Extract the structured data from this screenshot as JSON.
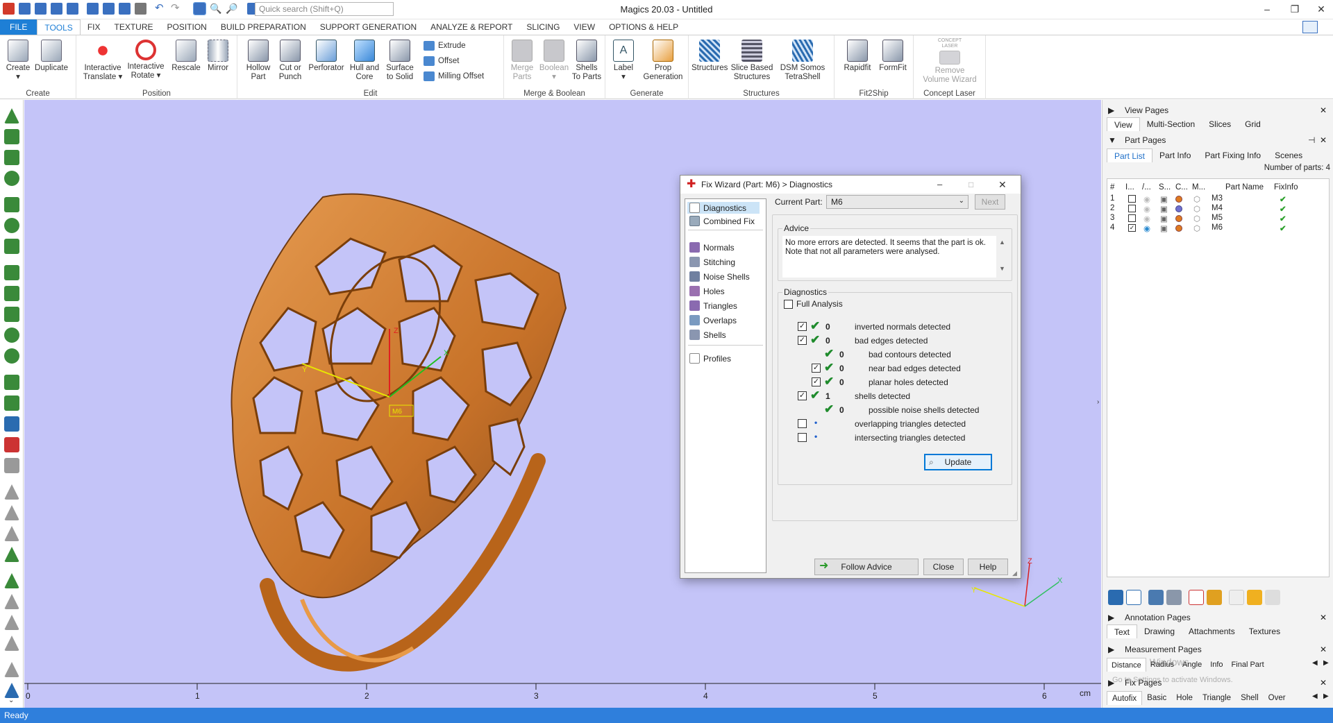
{
  "app": {
    "title": "Magics 20.03 - Untitled",
    "search_placeholder": "Quick search (Shift+Q)",
    "status": "Ready"
  },
  "menu_tabs": [
    "FILE",
    "TOOLS",
    "FIX",
    "TEXTURE",
    "POSITION",
    "BUILD PREPARATION",
    "SUPPORT GENERATION",
    "ANALYZE & REPORT",
    "SLICING",
    "VIEW",
    "OPTIONS & HELP"
  ],
  "ribbon": {
    "groups": [
      {
        "label": "Create",
        "buttons": [
          "Create",
          "Duplicate"
        ]
      },
      {
        "label": "Position",
        "buttons": [
          "Interactive Translate",
          "Interactive Rotate",
          "Rescale",
          "Mirror"
        ]
      },
      {
        "label": "Edit",
        "buttons": [
          "Hollow Part",
          "Cut or Punch",
          "Perforator",
          "Hull and Core",
          "Surface to Solid"
        ],
        "small": [
          "Extrude",
          "Offset",
          "Milling Offset"
        ]
      },
      {
        "label": "Merge & Boolean",
        "buttons": [
          "Merge Parts",
          "Boolean",
          "Shells To Parts"
        ]
      },
      {
        "label": "Generate",
        "buttons": [
          "Label",
          "Prop Generation"
        ]
      },
      {
        "label": "Structures",
        "buttons": [
          "Structures",
          "Slice Based Structures",
          "DSM Somos TetraShell"
        ]
      },
      {
        "label": "Fit2Ship",
        "buttons": [
          "Rapidfit",
          "FormFit"
        ]
      },
      {
        "label": "Concept Laser",
        "buttons": [
          "Remove Volume Wizard"
        ],
        "badge": "CONCEPT LASER"
      }
    ]
  },
  "viewport": {
    "ruler_ticks": [
      "0",
      "1",
      "2",
      "3",
      "4",
      "5",
      "6"
    ],
    "ruler_unit": "cm",
    "axis_labels": {
      "x": "X",
      "y": "Y",
      "z": "Z"
    },
    "part_tag": "M6"
  },
  "dialog": {
    "title": "Fix Wizard (Part: M6) > Diagnostics",
    "nav_top": [
      "Diagnostics",
      "Combined Fix"
    ],
    "nav_items": [
      "Normals",
      "Stitching",
      "Noise Shells",
      "Holes",
      "Triangles",
      "Overlaps",
      "Shells"
    ],
    "nav_bottom": [
      "Profiles"
    ],
    "current_part_label": "Current Part:",
    "current_part": "M6",
    "next_label": "Next",
    "advice_title": "Advice",
    "advice_text_1": "No more errors are detected. It seems that the part is ok.",
    "advice_text_2": "Note that not all parameters were analysed.",
    "diagnostics_title": "Diagnostics",
    "full_analysis_label": "Full Analysis",
    "rows": [
      {
        "checked": true,
        "indent": 0,
        "count": "0",
        "label": "inverted normals detected",
        "ok": true
      },
      {
        "checked": true,
        "indent": 0,
        "count": "0",
        "label": "bad edges detected",
        "ok": true
      },
      {
        "checked": null,
        "indent": 1,
        "count": "0",
        "label": "bad contours detected",
        "ok": true
      },
      {
        "checked": true,
        "indent": 1,
        "count": "0",
        "label": "near bad edges detected",
        "ok": true
      },
      {
        "checked": true,
        "indent": 1,
        "count": "0",
        "label": "planar holes detected",
        "ok": true
      },
      {
        "checked": true,
        "indent": 0,
        "count": "1",
        "label": "shells detected",
        "ok": true
      },
      {
        "checked": null,
        "indent": 1,
        "count": "0",
        "label": "possible noise shells detected",
        "ok": true
      },
      {
        "checked": false,
        "indent": 0,
        "count": "",
        "label": "overlapping triangles detected",
        "ok": false
      },
      {
        "checked": false,
        "indent": 0,
        "count": "",
        "label": "intersecting triangles detected",
        "ok": false
      }
    ],
    "update_label": "Update",
    "follow_advice_label": "Follow Advice",
    "close_label": "Close",
    "help_label": "Help"
  },
  "right_panel": {
    "view_pages": "View Pages",
    "view_tabs": [
      "View",
      "Multi-Section",
      "Slices",
      "Grid"
    ],
    "part_pages": "Part Pages",
    "part_tabs": [
      "Part List",
      "Part Info",
      "Part Fixing Info",
      "Scenes"
    ],
    "parts_count": "Number of parts: 4",
    "columns": [
      "#",
      "I...",
      "/...",
      "S...",
      "C...",
      "M...",
      "Part Name",
      "FixInfo"
    ],
    "parts": [
      {
        "num": "1",
        "checked": false,
        "name": "M3",
        "color": "#e07a20"
      },
      {
        "num": "2",
        "checked": false,
        "name": "M4",
        "color": "#7070d0"
      },
      {
        "num": "3",
        "checked": false,
        "name": "M5",
        "color": "#e07a20"
      },
      {
        "num": "4",
        "checked": true,
        "name": "M6",
        "color": "#e07a20"
      }
    ],
    "annotation_pages": "Annotation Pages",
    "annotation_tabs": [
      "Text",
      "Drawing",
      "Attachments",
      "Textures"
    ],
    "measurement_pages": "Measurement Pages",
    "measurement_tabs": [
      "Distance",
      "Radius",
      "Angle",
      "Info",
      "Final Part"
    ],
    "fix_pages": "Fix Pages",
    "fix_tabs": [
      "Autofix",
      "Basic",
      "Hole",
      "Triangle",
      "Shell",
      "Over"
    ],
    "watermark_1": "Activate Windows",
    "watermark_2": "Go to Settings to activate Windows."
  }
}
